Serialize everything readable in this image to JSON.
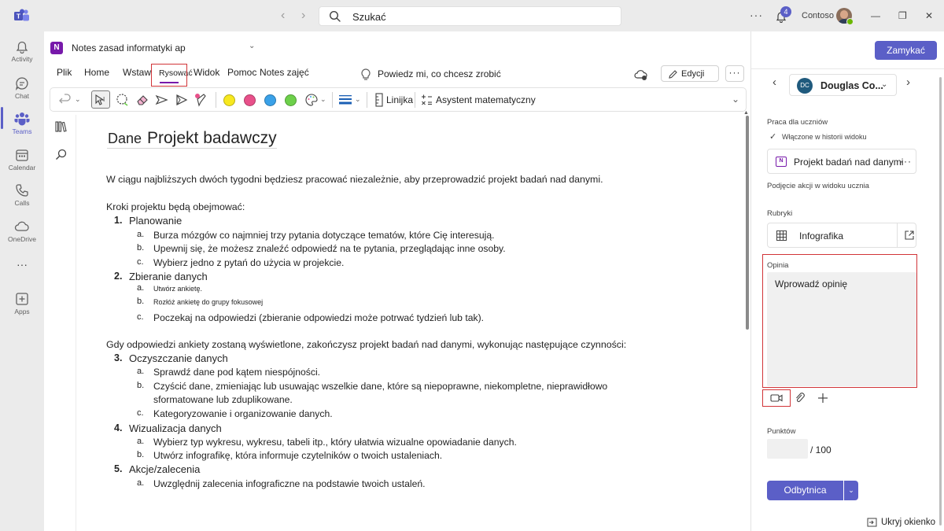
{
  "titlebar": {
    "search_placeholder": "Szukać",
    "notification_count": "4",
    "org_name": "Contoso",
    "more": "···"
  },
  "rail": {
    "items": [
      {
        "label": "Activity"
      },
      {
        "label": "Chat"
      },
      {
        "label": "Teams"
      },
      {
        "label": "Calendar"
      },
      {
        "label": "Calls"
      },
      {
        "label": "OneDrive"
      },
      {
        "label": "···"
      },
      {
        "label": "Apps"
      }
    ]
  },
  "onenote": {
    "notebook_title": "Notes zasad informatyki ap",
    "menu": {
      "tabs": [
        "Plik",
        "Home",
        "Wstaw",
        "Rysować",
        "Widok",
        "Pomoc",
        "Notes zajęć"
      ],
      "active_tab": "Rysować",
      "tell_me": "Powiedz mi, co chcesz zrobić",
      "edit_label": "Edycji",
      "more": "···"
    },
    "ribbon": {
      "pen_colors": [
        "#f7e81f",
        "#e8508a",
        "#3aa1e8",
        "#6dd04a"
      ],
      "ruler_label": "Linijka",
      "math_label": "Asystent matematyczny"
    },
    "page": {
      "date": "Dane",
      "title": "Projekt badawczy",
      "intro": "W ciągu najbliższych dwóch tygodni będziesz pracować niezależnie, aby przeprowadzić projekt badań nad danymi.",
      "steps_intro": "Kroki projektu będą obejmować:",
      "steps": [
        {
          "num": "1.",
          "title": "Planowanie",
          "subs": [
            {
              "letter": "a.",
              "text": "Burza mózgów co najmniej trzy pytania dotyczące tematów, które Cię interesują."
            },
            {
              "letter": "b.",
              "text": "Upewnij się, że możesz znaleźć odpowiedź na te pytania, przeglądając inne osoby."
            },
            {
              "letter": "c.",
              "text": "Wybierz jedno z pytań do użycia w projekcie."
            }
          ]
        },
        {
          "num": "2.",
          "title": "Zbieranie danych",
          "subs": [
            {
              "letter": "a.",
              "text": "Utwórz ankietę."
            },
            {
              "letter": "b.",
              "text": "Rozłóż ankietę do grupy fokusowej"
            },
            {
              "letter": "c.",
              "text": "Poczekaj na odpowiedzi (zbieranie odpowiedzi może potrwać tydzień lub tak)."
            }
          ]
        }
      ],
      "middle": "Gdy odpowiedzi ankiety zostaną wyświetlone, zakończysz projekt badań nad danymi, wykonując następujące czynności:",
      "steps2": [
        {
          "num": "3.",
          "title": "Oczyszczanie danych",
          "subs": [
            {
              "letter": "a.",
              "text": "Sprawdź dane pod kątem niespójności."
            },
            {
              "letter": "b.",
              "text": "Czyścić dane, zmieniając lub usuwając wszelkie dane, które są niepoprawne, niekompletne, nieprawidłowo"
            },
            {
              "letter": "",
              "text": "sformatowane lub zduplikowane."
            },
            {
              "letter": "c.",
              "text": "Kategoryzowanie i organizowanie danych."
            }
          ]
        },
        {
          "num": "4.",
          "title": "Wizualizacja danych",
          "subs": [
            {
              "letter": "a.",
              "text": "Wybierz typ wykresu, wykresu, tabeli itp., który ułatwia wizualne opowiadanie danych."
            },
            {
              "letter": "b.",
              "text": "Utwórz infografikę, która informuje czytelników o twoich ustaleniach."
            }
          ]
        },
        {
          "num": "5.",
          "title": "Akcje/zalecenia",
          "subs": [
            {
              "letter": "a.",
              "text": "Uwzględnij zalecenia infograficzne na podstawie twoich ustaleń."
            }
          ]
        }
      ]
    }
  },
  "panel": {
    "close_label": "Zamykać",
    "student_initials": "DC",
    "student_name": "Douglas Co...",
    "student_work_label": "Praca dla uczniów",
    "history_label": "Włączone w historii widoku",
    "work_item": "Projekt badań nad danymi",
    "student_actions_label": "Podjęcie akcji w widoku ucznia",
    "rubrics_label": "Rubryki",
    "rubric_item": "Infografika",
    "feedback_label": "Opinia",
    "feedback_placeholder": "Wprowadź opinię",
    "points_label": "Punktów",
    "points_value": "",
    "points_max": "/ 100",
    "return_label": "Odbytnica",
    "hide_label": "Ukryj okienko",
    "accent_color": "#5b5fc7"
  }
}
